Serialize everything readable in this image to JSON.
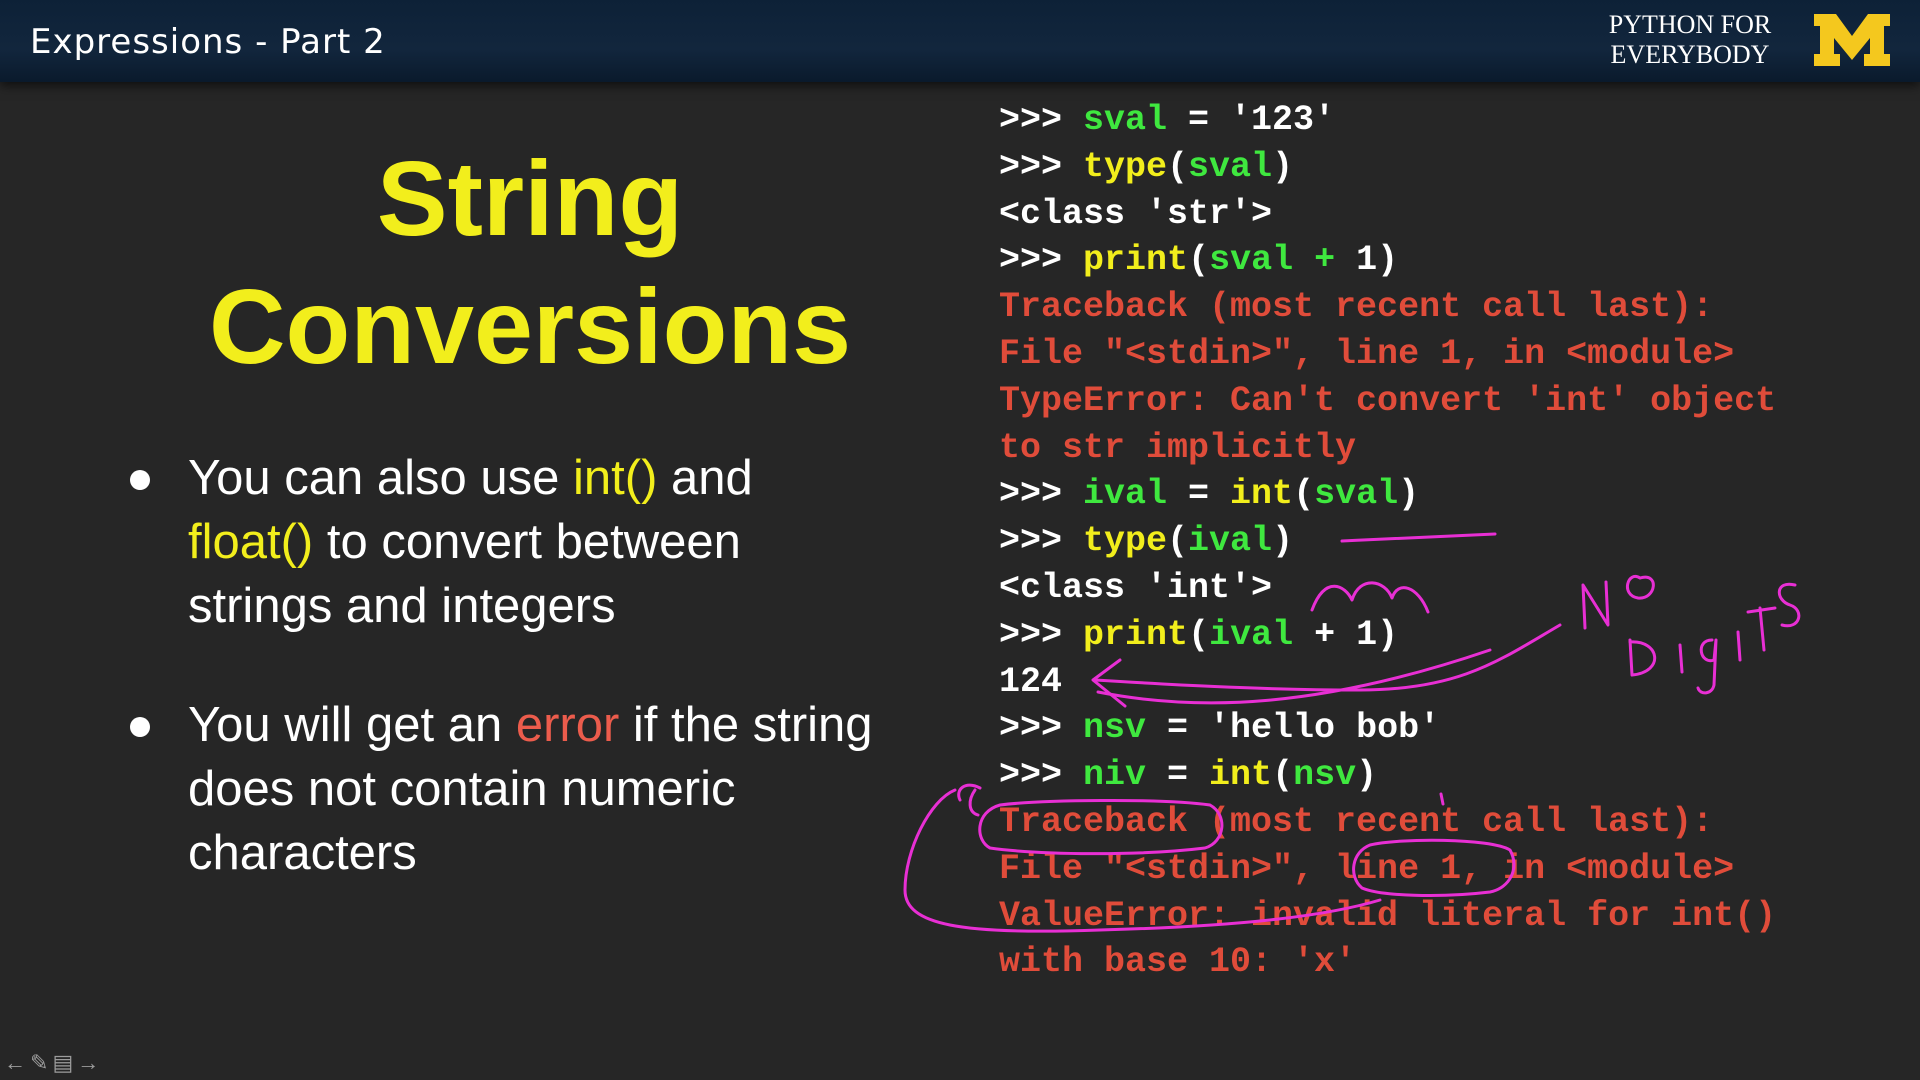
{
  "header": {
    "lecture_title": "Expressions - Part 2",
    "brand_line1": "PYTHON FOR",
    "brand_line2": "EVERYBODY",
    "logo_icon": "university-block-m-logo",
    "colors": {
      "bar": "#12263d",
      "logo": "#f4c81e"
    }
  },
  "slide": {
    "title_line1": "String",
    "title_line2": "Conversions",
    "bullets": [
      {
        "pre": "You can also use ",
        "hl1": "int()",
        "mid": " and",
        "hl2": "float()",
        "post": " to convert between strings and integers"
      },
      {
        "pre": "You will get an ",
        "hl": "error",
        "post": " if the string does not contain numeric characters"
      }
    ],
    "colors": {
      "heading": "#f2ee1c",
      "highlight": "#f2ee1c",
      "error": "#ec5c4c"
    }
  },
  "code_lines": [
    [
      {
        "t": ">>> ",
        "c": "plain"
      },
      {
        "t": "sval",
        "c": "green"
      },
      {
        "t": " = '123'",
        "c": "plain"
      }
    ],
    [
      {
        "t": ">>> ",
        "c": "plain"
      },
      {
        "t": "type",
        "c": "yellow"
      },
      {
        "t": "(",
        "c": "plain"
      },
      {
        "t": "sval",
        "c": "green"
      },
      {
        "t": ")",
        "c": "plain"
      }
    ],
    [
      {
        "t": "<class 'str'>",
        "c": "plain"
      }
    ],
    [
      {
        "t": ">>> ",
        "c": "plain"
      },
      {
        "t": "print",
        "c": "yellow"
      },
      {
        "t": "(",
        "c": "plain"
      },
      {
        "t": "sval",
        "c": "green"
      },
      {
        "t": " + ",
        "c": "green"
      },
      {
        "t": "1)",
        "c": "plain"
      }
    ],
    [
      {
        "t": "Traceback (most recent call last):",
        "c": "red"
      }
    ],
    [
      {
        "t": "File \"<stdin>\", line 1, in <module>",
        "c": "red"
      }
    ],
    [
      {
        "t": "TypeError: Can't convert 'int' object",
        "c": "red"
      }
    ],
    [
      {
        "t": "to str implicitly",
        "c": "red"
      }
    ],
    [
      {
        "t": ">>> ",
        "c": "plain"
      },
      {
        "t": "ival",
        "c": "green"
      },
      {
        "t": " = ",
        "c": "plain"
      },
      {
        "t": "int",
        "c": "yellow"
      },
      {
        "t": "(",
        "c": "plain"
      },
      {
        "t": "sval",
        "c": "green"
      },
      {
        "t": ")",
        "c": "plain"
      }
    ],
    [
      {
        "t": ">>> ",
        "c": "plain"
      },
      {
        "t": "type",
        "c": "yellow"
      },
      {
        "t": "(",
        "c": "plain"
      },
      {
        "t": "ival",
        "c": "green"
      },
      {
        "t": ")",
        "c": "plain"
      }
    ],
    [
      {
        "t": "<class 'int'>",
        "c": "plain"
      }
    ],
    [
      {
        "t": ">>> ",
        "c": "plain"
      },
      {
        "t": "print",
        "c": "yellow"
      },
      {
        "t": "(",
        "c": "plain"
      },
      {
        "t": "ival",
        "c": "green"
      },
      {
        "t": " + 1)",
        "c": "plain"
      }
    ],
    [
      {
        "t": "124",
        "c": "plain"
      }
    ],
    [
      {
        "t": ">>> ",
        "c": "plain"
      },
      {
        "t": "nsv",
        "c": "green"
      },
      {
        "t": " = 'hello bob'",
        "c": "plain"
      }
    ],
    [
      {
        "t": ">>> ",
        "c": "plain"
      },
      {
        "t": "niv",
        "c": "green"
      },
      {
        "t": " = ",
        "c": "plain"
      },
      {
        "t": "int",
        "c": "yellow"
      },
      {
        "t": "(",
        "c": "plain"
      },
      {
        "t": "nsv",
        "c": "green"
      },
      {
        "t": ")",
        "c": "plain"
      }
    ],
    [
      {
        "t": "Traceback (most recent call last):",
        "c": "red"
      }
    ],
    [
      {
        "t": "File \"<stdin>\", line 1, in <module>",
        "c": "red"
      }
    ],
    [
      {
        "t": "ValueError: invalid literal for int()",
        "c": "red"
      }
    ],
    [
      {
        "t": "with base 10: 'x'",
        "c": "red"
      }
    ]
  ],
  "annotation": {
    "handwritten_text": "NO DIGITS",
    "ink_color": "#e82fd4"
  },
  "nav_icons": [
    "arrow-left-icon",
    "pen-icon",
    "menu-icon",
    "arrow-right-icon"
  ]
}
